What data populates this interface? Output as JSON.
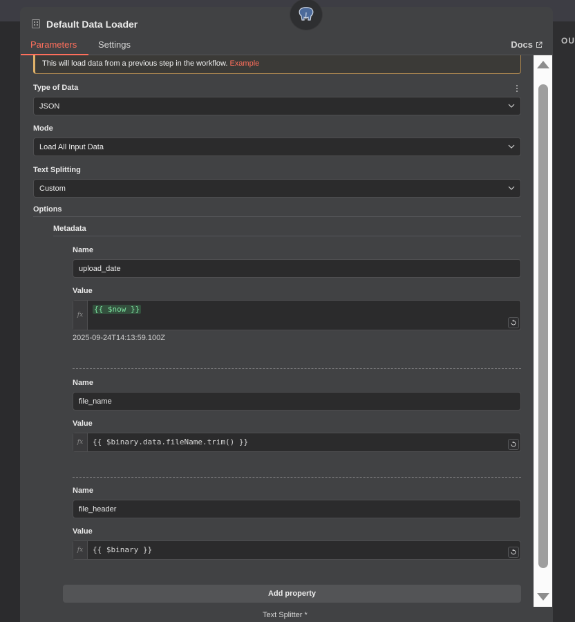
{
  "app": {
    "right_edge_text": "OU"
  },
  "header": {
    "title": "Default Data Loader",
    "tabs": [
      {
        "label": "Parameters",
        "active": true
      },
      {
        "label": "Settings",
        "active": false
      }
    ],
    "docs_label": "Docs"
  },
  "notice": {
    "text": "This will load data from a previous step in the workflow.",
    "link": "Example"
  },
  "fields": {
    "type_of_data": {
      "label": "Type of Data",
      "value": "JSON"
    },
    "mode": {
      "label": "Mode",
      "value": "Load All Input Data"
    },
    "text_splitting": {
      "label": "Text Splitting",
      "value": "Custom"
    }
  },
  "options": {
    "label": "Options",
    "metadata_label": "Metadata",
    "items": [
      {
        "name_label": "Name",
        "name": "upload_date",
        "value_label": "Value",
        "expression": "{{ $now }}",
        "preview": "2025-09-24T14:13:59.100Z"
      },
      {
        "name_label": "Name",
        "name": "file_name",
        "value_label": "Value",
        "expression": "{{ $binary.data.fileName.trim() }}"
      },
      {
        "name_label": "Name",
        "name": "file_header",
        "value_label": "Value",
        "expression": "{{ $binary }}"
      }
    ],
    "fx_label": "fx",
    "add_property_label": "Add property"
  },
  "footer": {
    "text_splitter_label": "Text Splitter *"
  },
  "colors": {
    "accent": "#ff6f5c",
    "warning_border": "#e0b26a",
    "panel": "#414244",
    "input_bg": "#2b2b2c"
  }
}
